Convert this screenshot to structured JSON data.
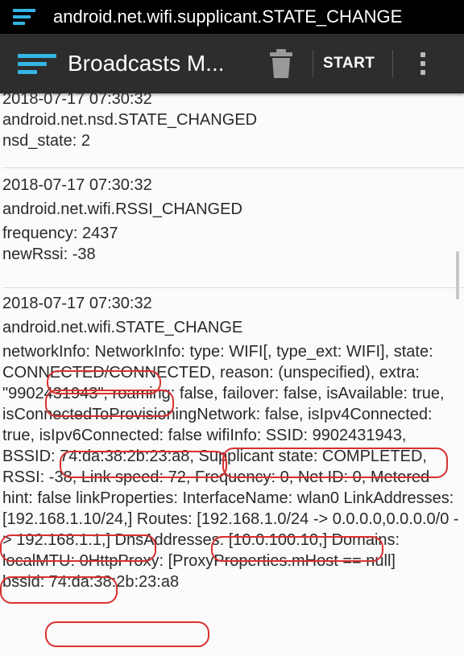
{
  "status_bar": {
    "menu_icon": "menu-icon",
    "title": "android.net.wifi.supplicant.STATE_CHANGE"
  },
  "action_bar": {
    "menu_icon": "menu-icon",
    "title": "Broadcasts M...",
    "trash_icon": "trash-icon",
    "start_label": "START",
    "overflow_icon": "overflow-menu-icon"
  },
  "colors": {
    "accent": "#33b5e5",
    "annotation": "#d93030",
    "action_bar_bg": "#2d2d2d"
  },
  "entries": [
    {
      "timestamp": "2018-07-17 07:30:32",
      "action": "android.net.nsd.STATE_CHANGED",
      "extras": [
        "nsd_state: 2"
      ]
    },
    {
      "timestamp": "2018-07-17 07:30:32",
      "action": "android.net.wifi.RSSI_CHANGED",
      "extras": [
        "frequency: 2437",
        "newRssi: -38"
      ]
    },
    {
      "timestamp": "2018-07-17 07:30:32",
      "action": "android.net.wifi.STATE_CHANGE",
      "network_info": "networkInfo: NetworkInfo: type: WIFI[, type_ext: WIFI], state: CONNECTED/CONNECTED, reason: (unspecified), extra: \"9902431943\", roaming: false, failover: false, isAvailable: true, isConnectedToProvisioningNetwork: false, isIpv4Connected: true, isIpv6Connected: false wifiInfo: SSID: 9902431943, BSSID: 74:da:38:2b:23:a8, Supplicant state: COMPLETED, RSSI: -38, Link speed: 72, Frequency: 0, Net ID: 0, Metered hint: false linkProperties: InterfaceName: wlan0 LinkAddresses: [192.168.1.10/24,] Routes: [192.168.1.0/24 -> 0.0.0.0,0.0.0.0/0 -> 192.168.1.1,] DnsAddresses: [10.0.100.10,] Domains: localMTU: 0HttpProxy: [ProxyProperties.mHost == null]",
      "bssid": "bssid: 74:da:38:2b:23:a8"
    }
  ]
}
